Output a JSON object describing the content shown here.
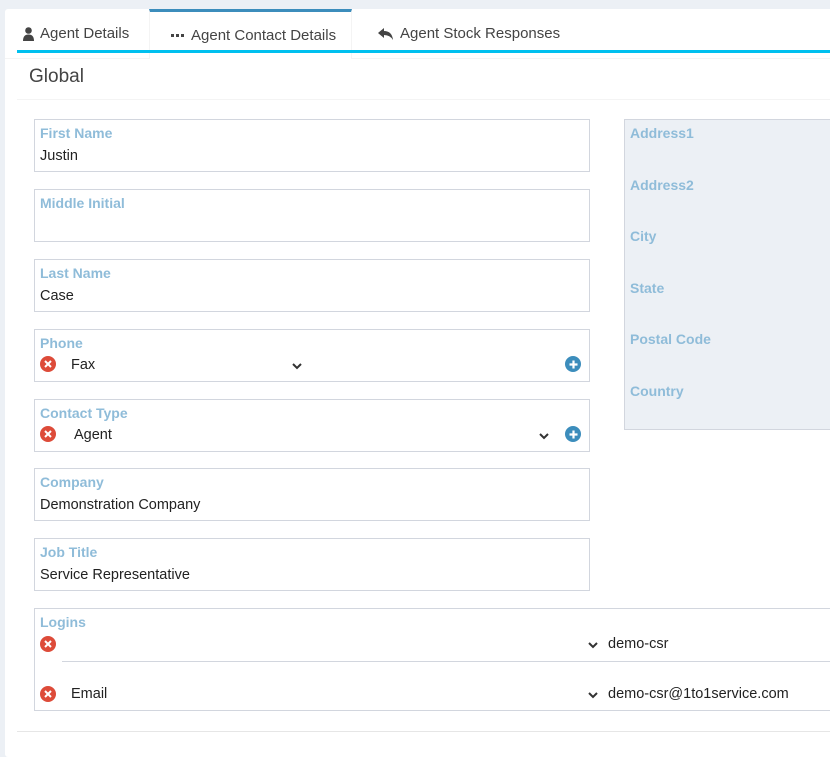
{
  "tabs": [
    {
      "label": "Agent Details",
      "icon": "user-icon",
      "active": false
    },
    {
      "label": "Agent Contact Details",
      "icon": "ellipsis-icon",
      "active": true
    },
    {
      "label": "Agent Stock Responses",
      "icon": "reply-icon",
      "active": false
    }
  ],
  "box": {
    "title": "Global"
  },
  "fields": {
    "first_name": {
      "label": "First Name",
      "value": "Justin"
    },
    "middle_initial": {
      "label": "Middle Initial",
      "value": ""
    },
    "last_name": {
      "label": "Last Name",
      "value": "Case"
    },
    "phone": {
      "label": "Phone",
      "type_value": "Fax"
    },
    "contact_type": {
      "label": "Contact Type",
      "value": "Agent"
    },
    "company": {
      "label": "Company",
      "value": "Demonstration Company"
    },
    "job_title": {
      "label": "Job Title",
      "value": "Service Representative"
    }
  },
  "address": {
    "labels": [
      "Address1",
      "Address2",
      "City",
      "State",
      "Postal Code",
      "Country"
    ]
  },
  "logins": {
    "label": "Logins",
    "rows": [
      {
        "type": "",
        "value": "demo-csr"
      },
      {
        "type": "Email",
        "value": "demo-csr@1to1service.com"
      }
    ]
  },
  "colors": {
    "active_tab_accent": "#3c8dbc",
    "box_accent": "#00c0ef",
    "label_color": "#8fbcd9",
    "remove": "#dd4b39",
    "add": "#3c8dbc"
  }
}
